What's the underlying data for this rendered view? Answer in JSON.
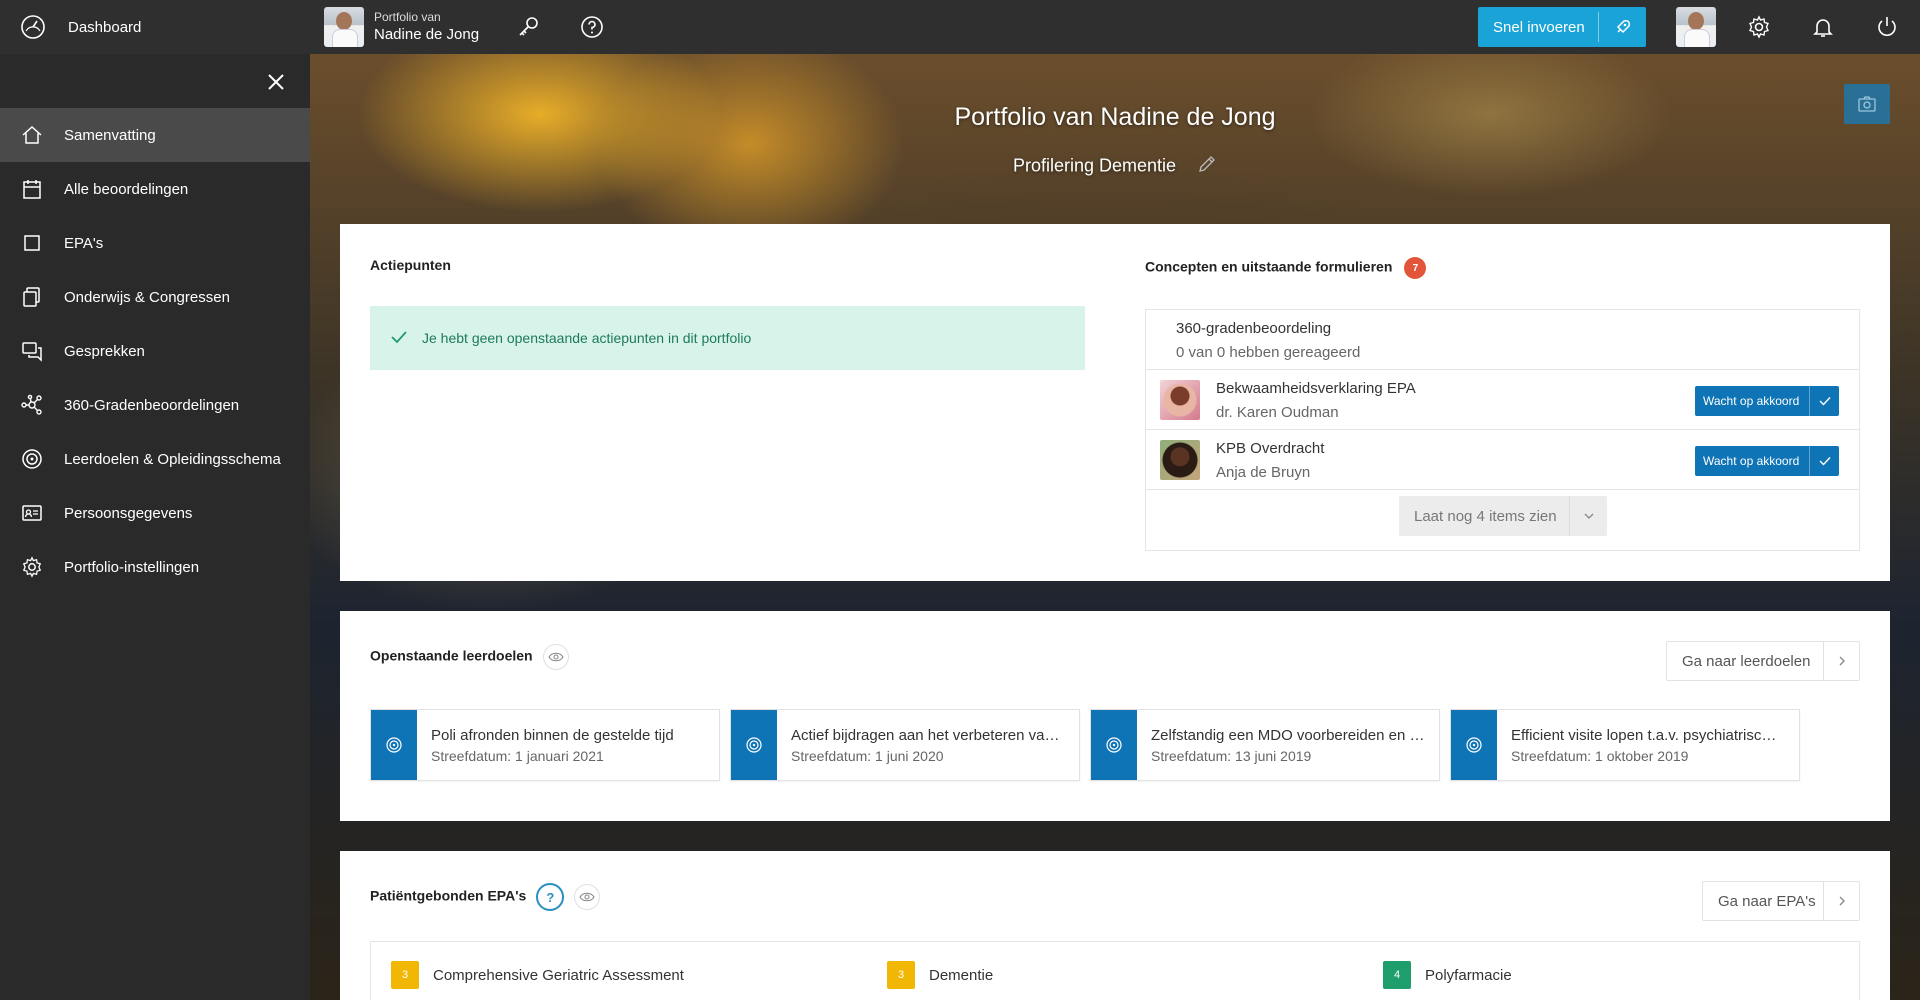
{
  "topbar": {
    "dashboard_label": "Dashboard",
    "portfolio_small": "Portfolio van",
    "portfolio_name": "Nadine de Jong",
    "snel_label": "Snel invoeren"
  },
  "sidebar": {
    "items": [
      {
        "label": "Samenvatting",
        "icon": "home-icon"
      },
      {
        "label": "Alle beoordelingen",
        "icon": "calendar-icon"
      },
      {
        "label": "EPA's",
        "icon": "square-icon"
      },
      {
        "label": "Onderwijs & Congressen",
        "icon": "documents-icon"
      },
      {
        "label": "Gesprekken",
        "icon": "chat-icon"
      },
      {
        "label": "360-Gradenbeoordelingen",
        "icon": "network-icon"
      },
      {
        "label": "Leerdoelen & Opleidingsschema",
        "icon": "target-icon"
      },
      {
        "label": "Persoonsgegevens",
        "icon": "id-card-icon"
      },
      {
        "label": "Portfolio-instellingen",
        "icon": "gear-icon"
      }
    ]
  },
  "hero": {
    "title": "Portfolio van Nadine de Jong",
    "subtitle": "Profilering Dementie"
  },
  "actiepunten": {
    "title": "Actiepunten",
    "empty_message": "Je hebt geen openstaande actiepunten in dit portfolio"
  },
  "concepten": {
    "title": "Concepten en uitstaande formulieren",
    "count": "7",
    "rows": [
      {
        "title": "360-gradenbeoordeling",
        "subtitle": "0 van 0 hebben gereageerd"
      },
      {
        "title": "Bekwaamheidsverklaring EPA",
        "subtitle": "dr. Karen Oudman",
        "status": "Wacht op akkoord"
      },
      {
        "title": "KPB Overdracht",
        "subtitle": "Anja de Bruyn",
        "status": "Wacht op akkoord"
      }
    ],
    "more_label": "Laat nog 4 items zien"
  },
  "leerdoelen": {
    "title": "Openstaande leerdoelen",
    "goto_label": "Ga naar leerdoelen",
    "items": [
      {
        "title": "Poli afronden binnen de gestelde tijd",
        "date": "Streefdatum: 1 januari 2021"
      },
      {
        "title": "Actief bijdragen aan het verbeteren va…",
        "date": "Streefdatum: 1 juni 2020"
      },
      {
        "title": "Zelfstandig een MDO voorbereiden en …",
        "date": "Streefdatum: 13 juni 2019"
      },
      {
        "title": "Efficient visite lopen t.a.v. psychiatrisc…",
        "date": "Streefdatum: 1 oktober 2019"
      }
    ]
  },
  "epas": {
    "title": "Patiëntgebonden EPA's",
    "help": "?",
    "goto_label": "Ga naar EPA's",
    "items": [
      {
        "level": "3",
        "label": "Comprehensive Geriatric Assessment",
        "color": "#f2b705"
      },
      {
        "level": "3",
        "label": "Dementie",
        "color": "#f2b705"
      },
      {
        "level": "4",
        "label": "Polyfarmacie",
        "color": "#1e9e6a"
      }
    ]
  }
}
